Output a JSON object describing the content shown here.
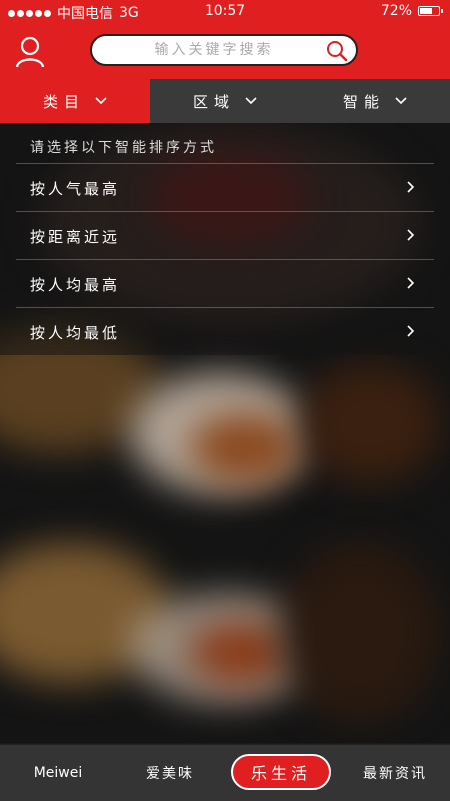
{
  "status_bar": {
    "carrier": "中国电信",
    "network": "3G",
    "time": "10:57",
    "battery": "72%",
    "battery_level": 0.72
  },
  "header": {
    "search_placeholder": "输入关键字搜索",
    "accent_color": "#e02020"
  },
  "filters": [
    {
      "label": "类目",
      "active": true
    },
    {
      "label": "区域",
      "active": false
    },
    {
      "label": "智能",
      "active": false
    }
  ],
  "sort_panel": {
    "title": "请选择以下智能排序方式",
    "options": [
      {
        "label": "按人气最高"
      },
      {
        "label": "按距离近远"
      },
      {
        "label": "按人均最高"
      },
      {
        "label": "按人均最低"
      }
    ]
  },
  "tab_bar": {
    "brand": "Meiwei",
    "tabs": [
      {
        "label": "爱美味"
      },
      {
        "label": "乐生活",
        "active": true
      },
      {
        "label": "最新资讯"
      }
    ]
  }
}
